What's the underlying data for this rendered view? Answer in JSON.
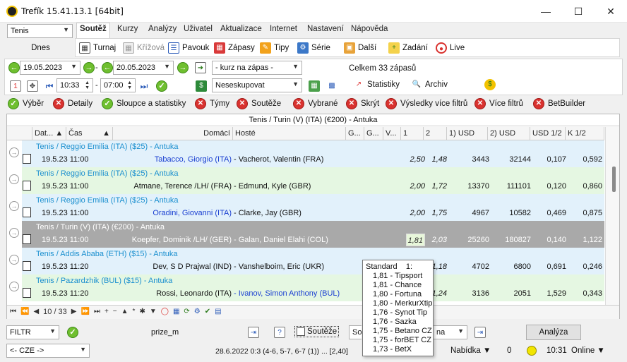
{
  "window": {
    "title": "Trefík 15.41.13.1 [64bit]"
  },
  "sport_select": "Tenis",
  "menu": [
    "Soutěž",
    "Kurzy",
    "Analýzy",
    "Uživatel",
    "Aktualizace",
    "Internet",
    "Nastavení",
    "Nápověda"
  ],
  "today_label": "Dnes",
  "toolbar": {
    "turnaj": "Turnaj",
    "krizova": "Křížová",
    "pavouk": "Pavouk",
    "zapasy": "Zápasy",
    "tipy": "Tipy",
    "serie": "Série",
    "dalsi": "Další",
    "zadani": "Zadání",
    "live": "Live"
  },
  "dates": {
    "from": "19.05.2023",
    "dash": "-",
    "to": "20.05.2023",
    "odds_select": "- kurz na zápas -",
    "total": "Celkem 33 zápasů"
  },
  "times": {
    "from": "10:33",
    "dash": "-",
    "to": "07:00",
    "group_select": "Neseskupovat",
    "statistiky": "Statistiky",
    "archiv": "Archiv"
  },
  "filters": [
    "Výběr",
    "Detaily",
    "Sloupce a statistiky",
    "Týmy",
    "Soutěže",
    "Vybrané",
    "Skrýt",
    "Výsledky více filtrů",
    "Více filtrů",
    "BetBuilder"
  ],
  "grid": {
    "caption": "Tenis / Turin (V) (ITA)  (€200) - Antuka",
    "headers": [
      "Dat...",
      "Čas",
      "Domácí",
      "Hosté",
      "G...",
      "G...",
      "V...",
      "1",
      "2",
      "1) USD",
      "2) USD",
      "USD 1/2",
      "K 1/2"
    ],
    "rows": [
      {
        "league": "Tenis / Reggio Emilia (ITA)  ($25) - Antuka",
        "date": "19.5.23 11:00",
        "home": "Tabacco, Giorgio (ITA)",
        "away": "- Vacherot, Valentin (FRA)",
        "o1": "2,50",
        "o2": "1,48",
        "usd1": "3443",
        "usd2": "32144",
        "u12": "0,107",
        "k12": "0,592",
        "home_color": "#1a3fd1",
        "away_color": "#111",
        "bg": "#e2f1fb"
      },
      {
        "league": "Tenis / Reggio Emilia (ITA)  ($25) - Antuka",
        "date": "19.5.23 11:00",
        "home": "Atmane, Terence /LH/ (FRA)",
        "away": "- Edmund, Kyle (GBR)",
        "o1": "2,00",
        "o2": "1,72",
        "usd1": "13370",
        "usd2": "111101",
        "u12": "0,120",
        "k12": "0,860",
        "home_color": "#111",
        "away_color": "#111",
        "bg": "#e5f7e2"
      },
      {
        "league": "Tenis / Reggio Emilia (ITA)  ($25) - Antuka",
        "date": "19.5.23 11:00",
        "home": "Oradini, Giovanni (ITA)",
        "away": "- Clarke, Jay (GBR)",
        "o1": "2,00",
        "o2": "1,75",
        "usd1": "4967",
        "usd2": "10582",
        "u12": "0,469",
        "k12": "0,875",
        "home_color": "#1a3fd1",
        "away_color": "#111",
        "bg": "#e2f1fb"
      },
      {
        "league": "Tenis / Turin (V) (ITA)  (€200) - Antuka",
        "date": "19.5.23 11:00",
        "home": "Koepfer, Dominik /LH/ (GER)",
        "away": "- Galan, Daniel Elahi (COL)",
        "o1": "1,81",
        "o2": "2,03",
        "usd1": "25260",
        "usd2": "180827",
        "u12": "0,140",
        "k12": "1,122",
        "home_color": "#fff",
        "away_color": "#fff",
        "bg": "#a9a9a9"
      },
      {
        "league": "Tenis / Addis Ababa (ETH)  ($15) - Antuka",
        "date": "19.5.23 11:20",
        "home": "Dev, S D Prajwal (IND)",
        "away": "- Vanshelboim, Eric (UKR)",
        "o1": "",
        "o2": "1,18",
        "usd1": "4702",
        "usd2": "6800",
        "u12": "0,691",
        "k12": "0,246",
        "home_color": "#111",
        "away_color": "#111",
        "bg": "#e2f1fb"
      },
      {
        "league": "Tenis / Pazardzhik (BUL)  ($15) - Antuka",
        "date": "19.5.23 11:20",
        "home": "Rossi, Leonardo (ITA)",
        "away": "- Ivanov, Simon Anthony (BUL)",
        "o1": "",
        "o2": "1,24",
        "usd1": "3136",
        "usd2": "2051",
        "u12": "1,529",
        "k12": "0,343",
        "home_color": "#111",
        "away_color": "#1a3fd1",
        "bg": "#e5f7e2"
      }
    ]
  },
  "pager": {
    "label": "10 / 33"
  },
  "tooltip": {
    "title": "Standard",
    "col": "1:",
    "lines": [
      "1,81 - Tipsport",
      "1,81 - Chance",
      "1,80 - Fortuna",
      "1,80 - MerkurXtip",
      "1,76 - Synot Tip",
      "1,76 - Sazka",
      "1,75 - Betano CZ",
      "1,75 - forBET CZ",
      "1,73 - BetX"
    ]
  },
  "bottom": {
    "filter_select": "FILTR",
    "prize": "prize_m",
    "souteze": "Soutěže",
    "so": "So",
    "na": "na",
    "analyza": "Analýza"
  },
  "status": {
    "country": "<- CZE ->",
    "result": "28.6.2022 0:3 (4-6, 5-7, 6-7 (1)) ... [2,40]",
    "nabidka": "Nabídka ▼",
    "zero": "0",
    "time": "10:31",
    "online": "Online ▼"
  }
}
